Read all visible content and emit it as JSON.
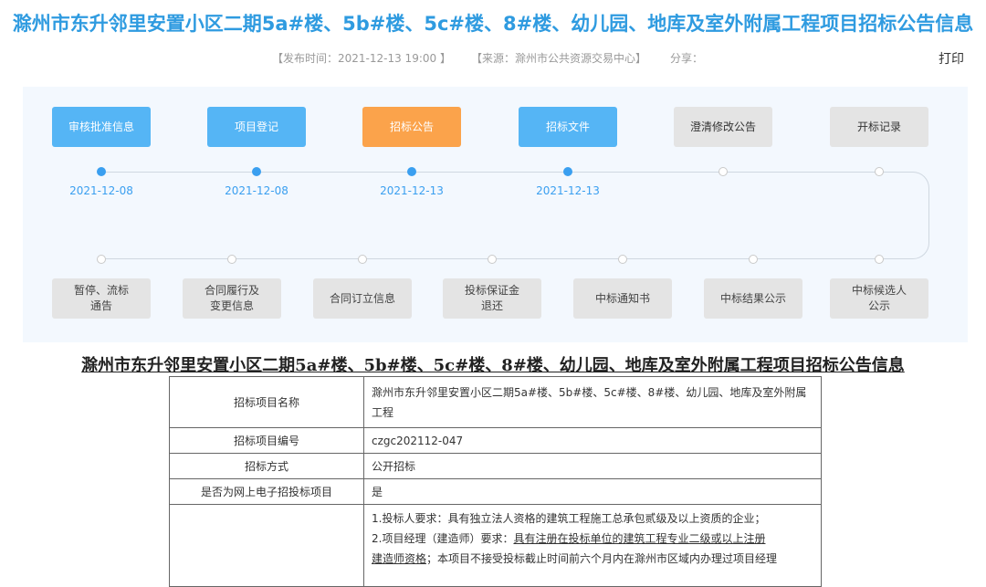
{
  "page": {
    "title": "滁州市东升邻里安置小区二期5a#楼、5b#楼、5c#楼、8#楼、幼儿园、地库及室外附属工程项目招标公告信息",
    "publish_time": "【发布时间：2021-12-13 19:00 】",
    "source": "【来源：滁州市公共资源交易中心】",
    "share": "分享：",
    "print": "打印"
  },
  "flow": {
    "top": [
      {
        "label": "审核批准信息",
        "date": "2021-12-08",
        "state": "blue"
      },
      {
        "label": "项目登记",
        "date": "2021-12-08",
        "state": "blue"
      },
      {
        "label": "招标公告",
        "date": "2021-12-13",
        "state": "orange"
      },
      {
        "label": "招标文件",
        "date": "2021-12-13",
        "state": "blue"
      },
      {
        "label": "澄清修改公告",
        "date": "",
        "state": "gray"
      },
      {
        "label": "开标记录",
        "date": "",
        "state": "gray"
      }
    ],
    "bottom": [
      {
        "label": "暂停、流标\n通告"
      },
      {
        "label": "合同履行及\n变更信息"
      },
      {
        "label": "合同订立信息"
      },
      {
        "label": "投标保证金\n退还"
      },
      {
        "label": "中标通知书"
      },
      {
        "label": "中标结果公示"
      },
      {
        "label": "中标候选人\n公示"
      }
    ]
  },
  "notice": {
    "subtitle": "滁州市东升邻里安置小区二期5a#楼、5b#楼、5c#楼、8#楼、幼儿园、地库及室外附属工程项目招标公告信息",
    "rows": [
      {
        "k": "招标项目名称",
        "v": "滁州市东升邻里安置小区二期5a#楼、5b#楼、5c#楼、8#楼、幼儿园、地库及室外附属工程"
      },
      {
        "k": "招标项目编号",
        "v": "czgc202112-047"
      },
      {
        "k": "招标方式",
        "v": "公开招标"
      },
      {
        "k": "是否为网上电子招投标项目",
        "v": "是"
      }
    ],
    "requirements": {
      "line1": "1.投标人要求：具有独立法人资格的建筑工程施工总承包贰级及以上资质的企业；",
      "line2_prefix": "2.项目经理（建造师）要求：",
      "line2_underlined": "具有注册在投标单位的建筑工程专业二级或以上注册",
      "line3_underlined": "建造师资格",
      "line3_rest": "；本项目不接受投标截止时间前六个月内在滁州市区域内办理过项目经理"
    }
  }
}
